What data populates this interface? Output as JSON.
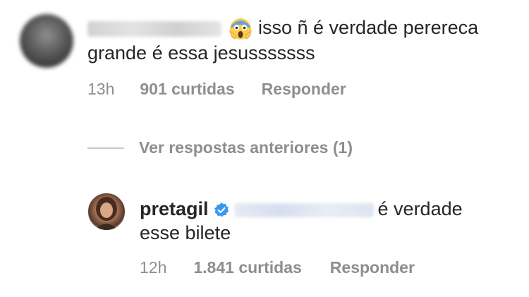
{
  "comment1": {
    "text_line1": "isso ñ é verdade perereca",
    "text_line2": "grande é essa jesusssssss",
    "emoji": "😱",
    "time": "13h",
    "likes": "901 curtidas",
    "reply_label": "Responder"
  },
  "view_replies": {
    "label": "Ver respostas anteriores (1)"
  },
  "comment2": {
    "username": "pretagil",
    "text_line1_suffix": "é verdade",
    "text_line2": "esse bilete",
    "time": "12h",
    "likes": "1.841 curtidas",
    "reply_label": "Responder"
  },
  "colors": {
    "text": "#262626",
    "muted": "#8e8e8e",
    "verified": "#3897f0"
  }
}
